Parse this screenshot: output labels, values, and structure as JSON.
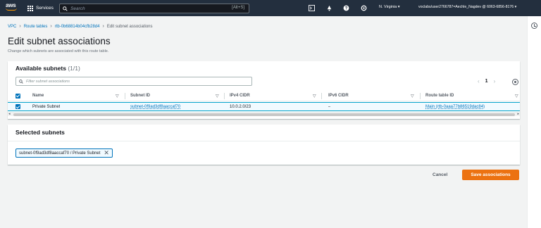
{
  "topnav": {
    "logo_text": "aws",
    "services_label": "Services",
    "search_placeholder": "Search",
    "search_shortcut": "[Alt+S]",
    "region": "N. Virginia ▾",
    "account": "voclabs/user2766787=Aechle_Nagdev @ 6063-6856-8176 ▾"
  },
  "breadcrumb": {
    "items": [
      "VPC",
      "Route tables",
      "rtb-0b68814b04cfb28d4"
    ],
    "current": "Edit subnet associations"
  },
  "page": {
    "title": "Edit subnet associations",
    "description": "Change which subnets are associated with this route table."
  },
  "available": {
    "title": "Available subnets",
    "count": "(1/1)",
    "filter_placeholder": "Filter subnet associations",
    "page_number": "1",
    "columns": [
      "Name",
      "Subnet ID",
      "IPv4 CIDR",
      "IPv6 CIDR",
      "Route table ID"
    ],
    "rows": [
      {
        "name": "Private Subnet",
        "subnet_id": "subnet-0f9ad3df8aaccaf70",
        "ipv4": "10.0.2.0/23",
        "ipv6": "–",
        "route_table": "Main (rtb-0aaa77b86519dac84)"
      }
    ]
  },
  "selected": {
    "title": "Selected subnets",
    "token": "subnet-0f9ad3df8aaccaf70 / Private Subnet"
  },
  "actions": {
    "cancel": "Cancel",
    "save": "Save associations"
  },
  "colors": {
    "nav_bg": "#232f3e",
    "link": "#0073bb",
    "primary_button": "#ec7211",
    "selected_row": "#f1faff"
  }
}
